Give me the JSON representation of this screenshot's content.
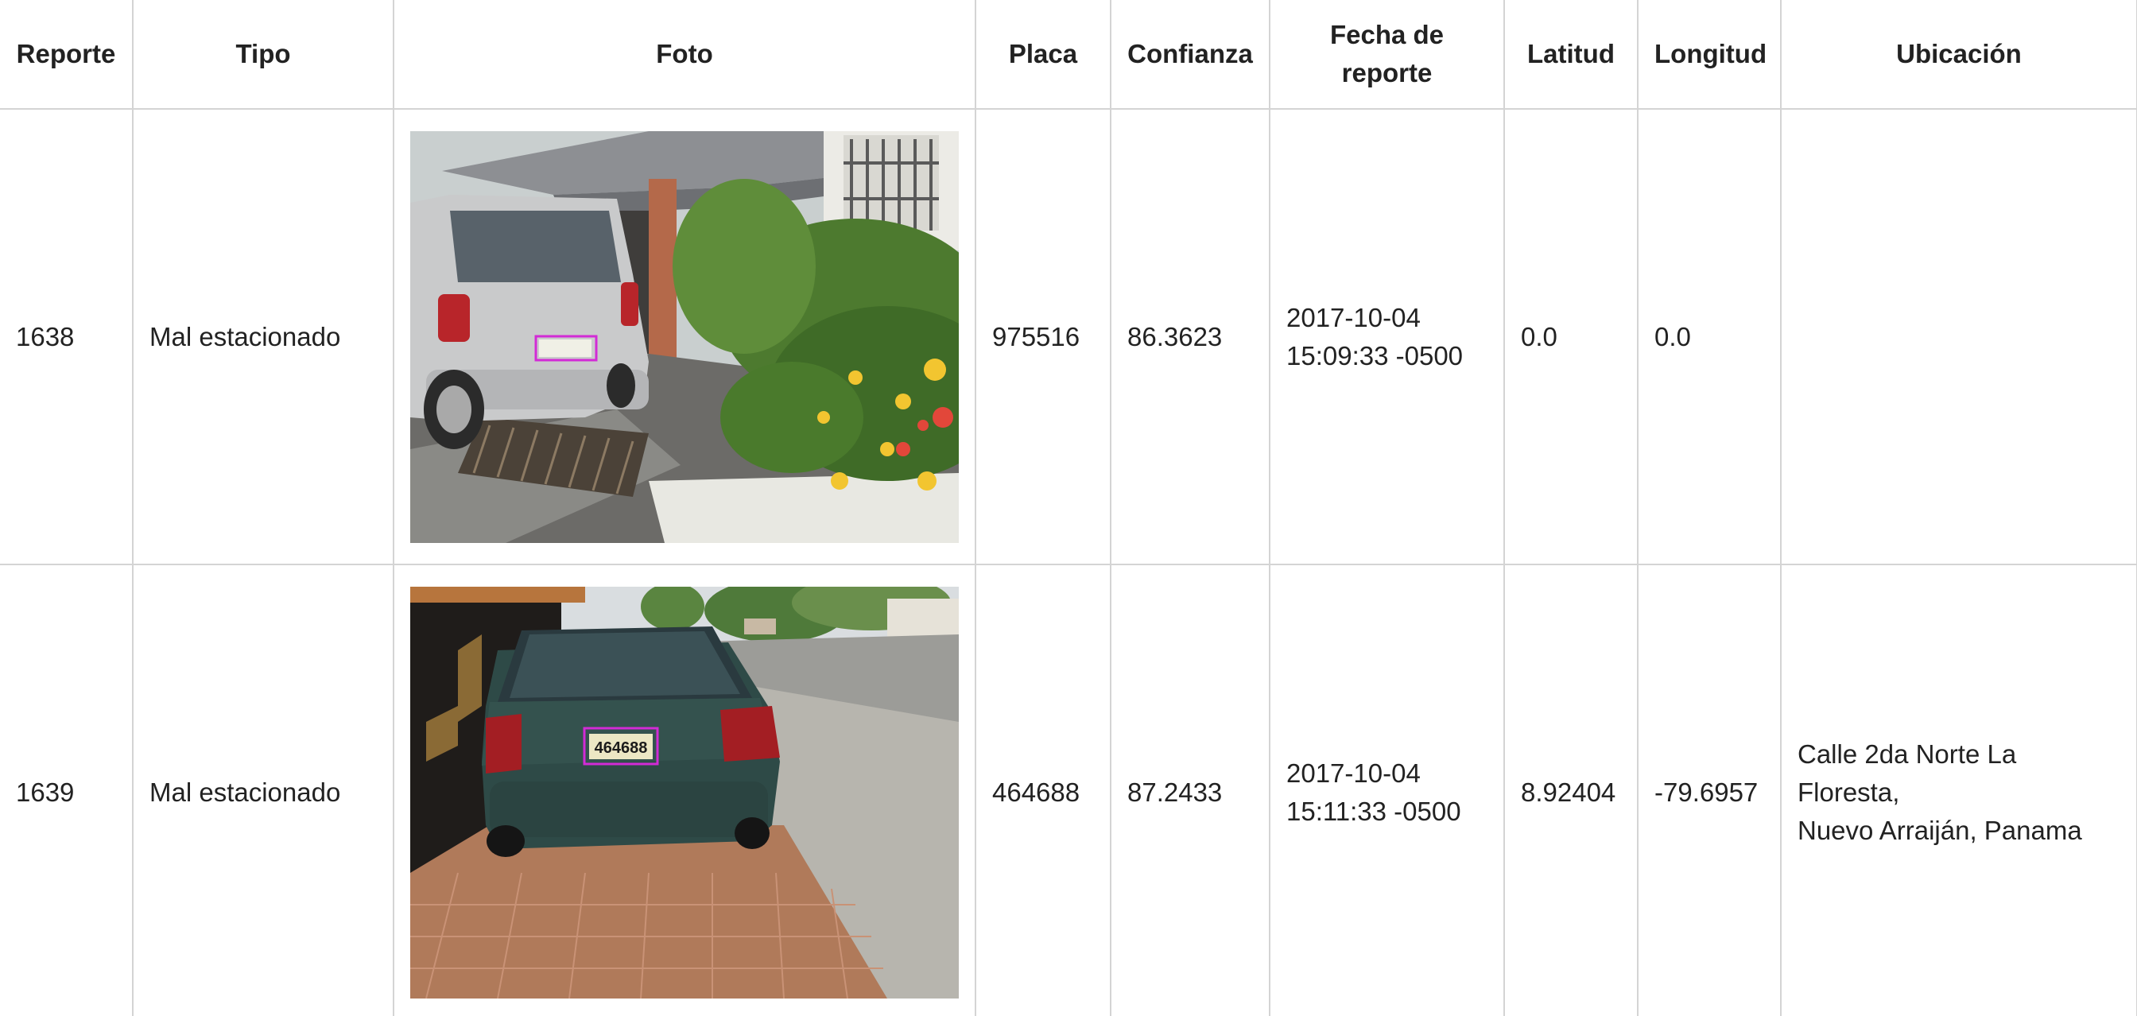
{
  "table": {
    "headers": {
      "reporte": "Reporte",
      "tipo": "Tipo",
      "foto": "Foto",
      "placa": "Placa",
      "confianza": "Confianza",
      "fecha": "Fecha de reporte",
      "latitud": "Latitud",
      "longitud": "Longitud",
      "ubicacion": "Ubicación"
    },
    "rows": [
      {
        "reporte": "1638",
        "tipo": "Mal estacionado",
        "foto": "photo-silver-minivan",
        "placa": "975516",
        "confianza": "86.3623",
        "fecha_line1": "2017-10-04",
        "fecha_line2": "15:09:33 -0500",
        "latitud": "0.0",
        "longitud": "0.0",
        "ubicacion_line1": "",
        "ubicacion_line2": ""
      },
      {
        "reporte": "1639",
        "tipo": "Mal estacionado",
        "foto": "photo-dark-green-sedan",
        "placa": "464688",
        "confianza": "87.2433",
        "fecha_line1": "2017-10-04",
        "fecha_line2": "15:11:33 -0500",
        "latitud": "8.92404",
        "longitud": "-79.6957",
        "ubicacion_line1": "Calle 2da Norte La Floresta,",
        "ubicacion_line2": "Nuevo Arraiján, Panama"
      }
    ]
  },
  "colors": {
    "border": "#d4d4d4",
    "text": "#222222",
    "plate_box": "#d22bd6"
  }
}
